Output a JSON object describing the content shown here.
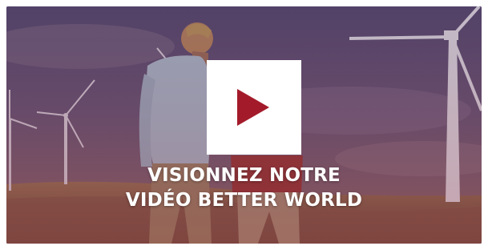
{
  "video": {
    "caption_line1": "VISIONNEZ NOTRE",
    "caption_line2": "VIDÉO BETTER WORLD",
    "overlay_color": "#7a2035",
    "play_button_color": "#ffffff",
    "play_icon_color": "#a31b2a",
    "play_icon": "play-icon"
  }
}
